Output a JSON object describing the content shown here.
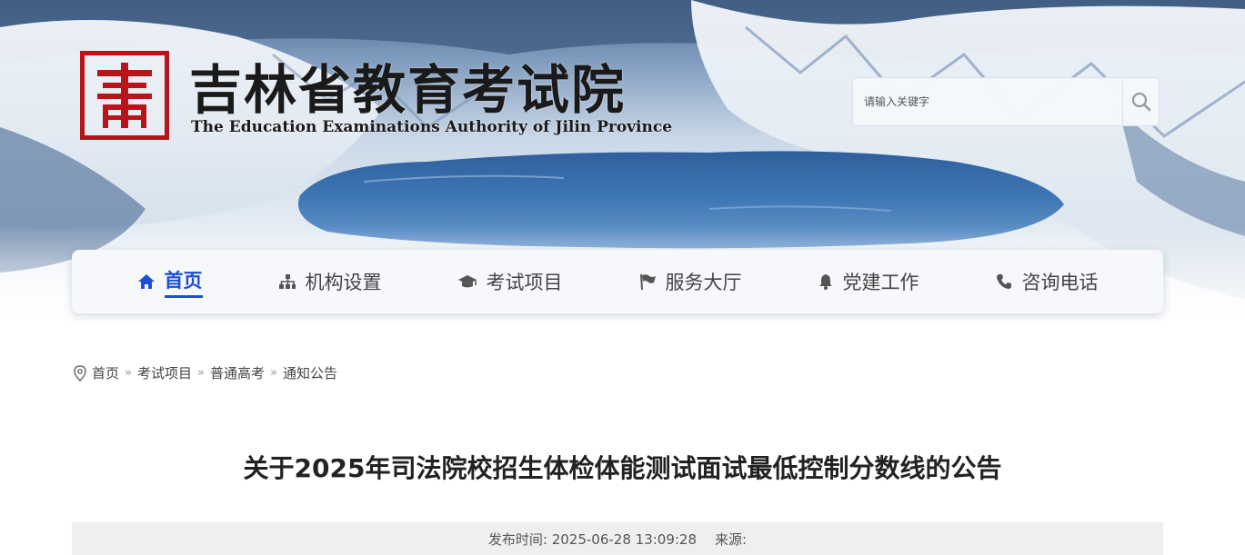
{
  "header": {
    "logo_glyph": "青",
    "site_title": "吉林省教育考试院",
    "site_subtitle": "The Education Examinations Authority of Jilin Province",
    "brand_red": "#b8141a"
  },
  "search": {
    "placeholder": "请输入关键字",
    "value": ""
  },
  "nav": {
    "accent": "#1c4fd6",
    "items": [
      {
        "label": "首页",
        "icon": "home-icon",
        "active": true
      },
      {
        "label": "机构设置",
        "icon": "sitemap-icon",
        "active": false
      },
      {
        "label": "考试项目",
        "icon": "graduation-cap-icon",
        "active": false
      },
      {
        "label": "服务大厅",
        "icon": "flag-icon",
        "active": false
      },
      {
        "label": "党建工作",
        "icon": "bell-icon",
        "active": false
      },
      {
        "label": "咨询电话",
        "icon": "phone-icon",
        "active": false
      }
    ]
  },
  "breadcrumb": {
    "icon": "location-pin-icon",
    "items": [
      "首页",
      "考试项目",
      "普通高考",
      "通知公告"
    ],
    "separator": "»"
  },
  "article": {
    "title": "关于2025年司法院校招生体检体能测试面试最低控制分数线的公告",
    "publish_label": "发布时间: 2025-06-28 13:09:28",
    "source_label": "来源:"
  }
}
